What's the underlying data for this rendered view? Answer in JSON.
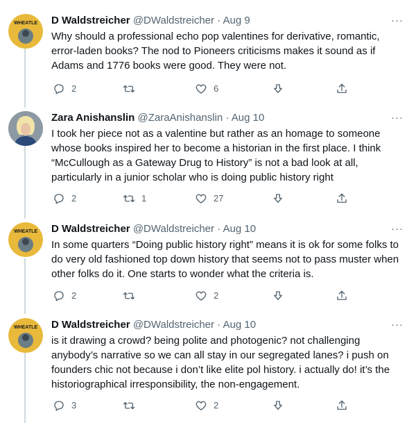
{
  "tweets": [
    {
      "name": "D Waldstreicher",
      "handle": "@DWaldstreicher",
      "date": "Aug 9",
      "text": "Why should a professional echo pop valentines for derivative, romantic, error-laden books? The nod to Pioneers criticisms makes it sound as if Adams and 1776 books were good. They were not.",
      "replies": "2",
      "retweets": "",
      "likes": "6",
      "avatar_text": "WHEATLE"
    },
    {
      "name": "Zara Anishanslin",
      "handle": "@ZaraAnishanslin",
      "date": "Aug 10",
      "text": "I took her piece not as a valentine but rather as an homage to someone whose books inspired her to become a historian in the first place. I think “McCullough as a Gateway Drug to History” is not a bad look at all, particularly in a junior scholar who is doing public history right",
      "replies": "2",
      "retweets": "1",
      "likes": "27"
    },
    {
      "name": "D Waldstreicher",
      "handle": "@DWaldstreicher",
      "date": "Aug 10",
      "text": "In some quarters “Doing public history right” means it is ok for some folks to do very old fashioned top down history that seems not to pass muster when other folks do it. One starts to wonder what the criteria is.",
      "replies": "2",
      "retweets": "",
      "likes": "2",
      "avatar_text": "WHEATLE"
    },
    {
      "name": "D Waldstreicher",
      "handle": "@DWaldstreicher",
      "date": "Aug 10",
      "text": "is it drawing a crowd? being polite and photogenic? not challenging anybody’s narrative so we can all stay in our segregated lanes? i push on founders chic not because i don’t like elite pol history. i actually do! it’s the historiographical irresponsibility, the non-engagement.",
      "replies": "3",
      "retweets": "",
      "likes": "2",
      "avatar_text": "WHEATLE"
    }
  ],
  "separator": "·",
  "more_label": "···",
  "colors": {
    "text": "#0f1419",
    "muted": "#536471",
    "thread_line": "#cfd9de",
    "avatar_gold": "#e8b93a"
  },
  "icons": [
    "reply-icon",
    "retweet-icon",
    "like-icon",
    "download-icon",
    "share-icon",
    "more-icon"
  ]
}
